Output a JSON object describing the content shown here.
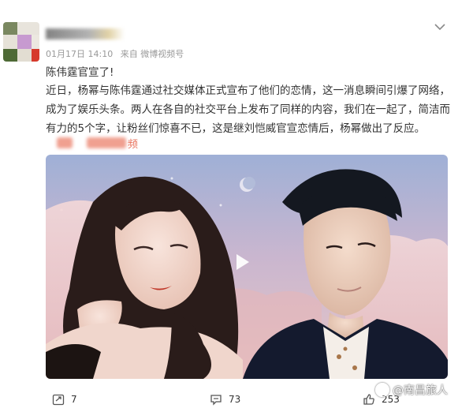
{
  "post": {
    "timestamp": "01月17日 14:10",
    "source": "来自 微博视频号",
    "headline": "陈伟霆官宣了!",
    "body_lines": [
      "近日，杨幂与陈伟霆通过社交媒体正式宣布了他们的恋情，这一消息瞬间引爆了网络，",
      "成为了娱乐头条。两人在各自的社交平台上发布了同样的内容，我们在一起了，简洁而",
      "有力的5个字，让粉丝们惊喜不已，这是继刘恺威官宣恋情后，杨幂做出了反应。"
    ],
    "link_suffix": "频"
  },
  "media": {
    "type": "video",
    "icon": "play-icon"
  },
  "actions": {
    "repost_count": "7",
    "comment_count": "73",
    "like_count": "253"
  },
  "watermark": {
    "text": "@南昌旅人"
  },
  "colors": {
    "text": "#333333",
    "meta": "#999999",
    "accent": "#e8705a"
  }
}
